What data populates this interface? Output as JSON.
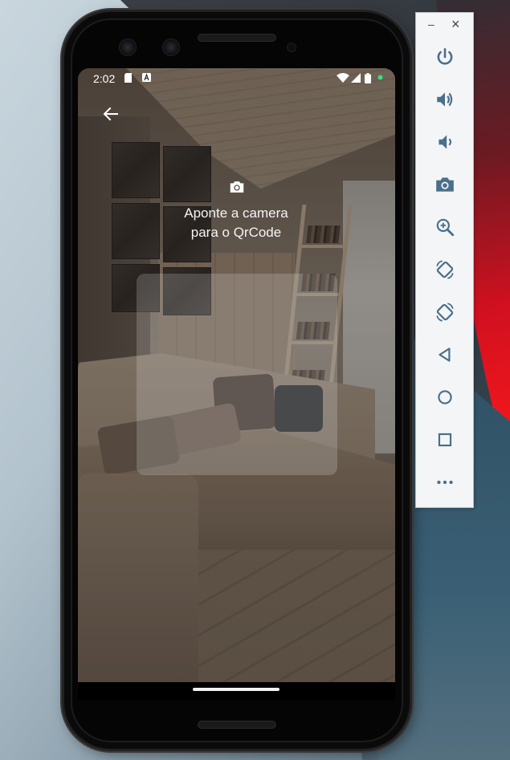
{
  "status_bar": {
    "time": "2:02"
  },
  "screen": {
    "instruction_line1": "Aponte a camera",
    "instruction_line2": "para o QrCode"
  },
  "emulator_toolbar": {
    "minimize_label": "–",
    "close_label": "×",
    "buttons": [
      "power-icon",
      "volume-up-icon",
      "volume-down-icon",
      "screenshot-camera-icon",
      "zoom-icon",
      "rotate-left-icon",
      "rotate-right-icon",
      "back-triangle-icon",
      "home-circle-icon",
      "overview-square-icon",
      "more-icon"
    ]
  },
  "colors": {
    "toolbar_icon": "#4a6f8a",
    "status_dot": "#3ddc84",
    "screen_text": "#f4f4f4"
  }
}
